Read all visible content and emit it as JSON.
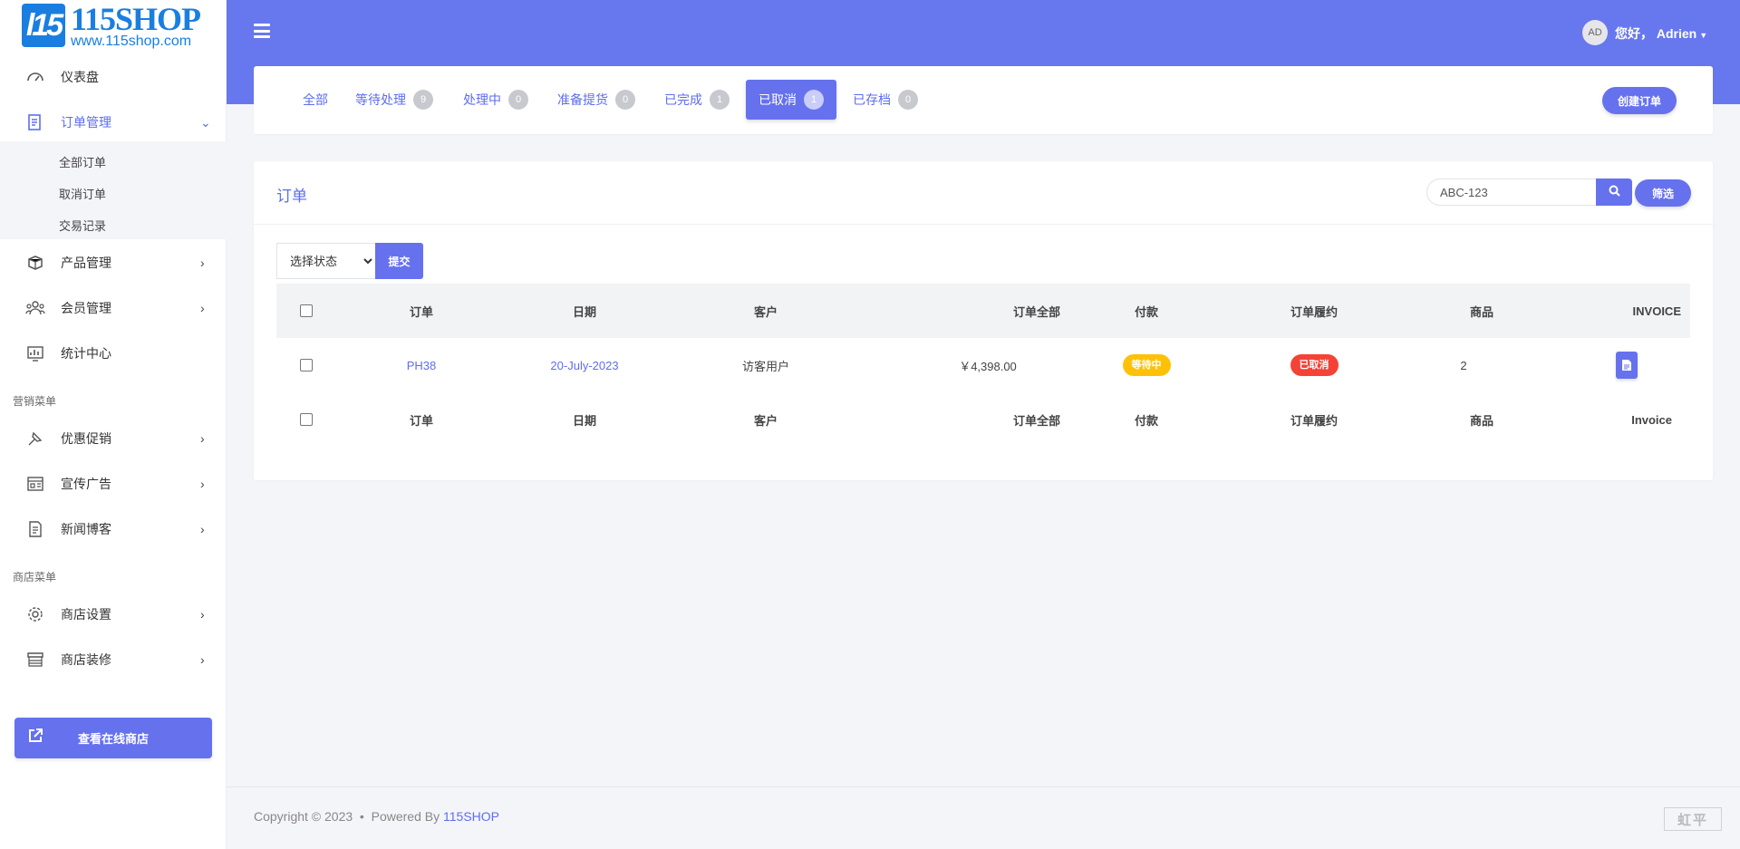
{
  "brand": {
    "logo_mark": "l15",
    "name": "115SHOP",
    "url": "www.115shop.com"
  },
  "sidebar": {
    "items": [
      {
        "label": "仪表盘",
        "icon": "dashboard-icon"
      },
      {
        "label": "订单管理",
        "icon": "orders-icon",
        "active": true,
        "expanded": true
      },
      {
        "label": "产品管理",
        "icon": "products-icon"
      },
      {
        "label": "会员管理",
        "icon": "members-icon"
      },
      {
        "label": "统计中心",
        "icon": "stats-icon"
      },
      {
        "label": "优惠促销",
        "icon": "promotion-icon"
      },
      {
        "label": "宣传广告",
        "icon": "ads-icon"
      },
      {
        "label": "新闻博客",
        "icon": "news-icon"
      },
      {
        "label": "商店设置",
        "icon": "gear-icon"
      },
      {
        "label": "商店装修",
        "icon": "store-icon"
      }
    ],
    "sub_items": [
      "全部订单",
      "取消订单",
      "交易记录"
    ],
    "sections": [
      "营销菜单",
      "商店菜单"
    ],
    "visit_store": "查看在线商店"
  },
  "header": {
    "avatar": "AD",
    "greeting": "您好， Adrien"
  },
  "tabs": [
    {
      "label": "全部",
      "count": null
    },
    {
      "label": "等待处理",
      "count": "9"
    },
    {
      "label": "处理中",
      "count": "0"
    },
    {
      "label": "准备提货",
      "count": "0"
    },
    {
      "label": "已完成",
      "count": "1"
    },
    {
      "label": "已取消",
      "count": "1",
      "active": true
    },
    {
      "label": "已存档",
      "count": "0"
    }
  ],
  "create_order": "创建订单",
  "orders": {
    "title": "订单",
    "search_value": "ABC-123",
    "filter_label": "筛选",
    "status_select": "选择状态",
    "submit_label": "提交",
    "columns": [
      "订单",
      "日期",
      "客户",
      "订单全部",
      "付款",
      "订单履约",
      "商品",
      "INVOICE"
    ],
    "footer_columns": [
      "订单",
      "日期",
      "客户",
      "订单全部",
      "付款",
      "订单履约",
      "商品",
      "Invoice"
    ],
    "rows": [
      {
        "order": "PH38",
        "date": "20-July-2023",
        "customer": "访客用户",
        "total": "￥4,398.00",
        "payment": "等待中",
        "fulfillment": "已取消",
        "items": "2"
      }
    ]
  },
  "colors": {
    "accent": "#6671ee",
    "pending": "#ffc107",
    "cancelled": "#f44336"
  },
  "footer": {
    "copyright": "Copyright © 2023  •  Powered By ",
    "brand": "115SHOP",
    "mark": "虹平"
  }
}
